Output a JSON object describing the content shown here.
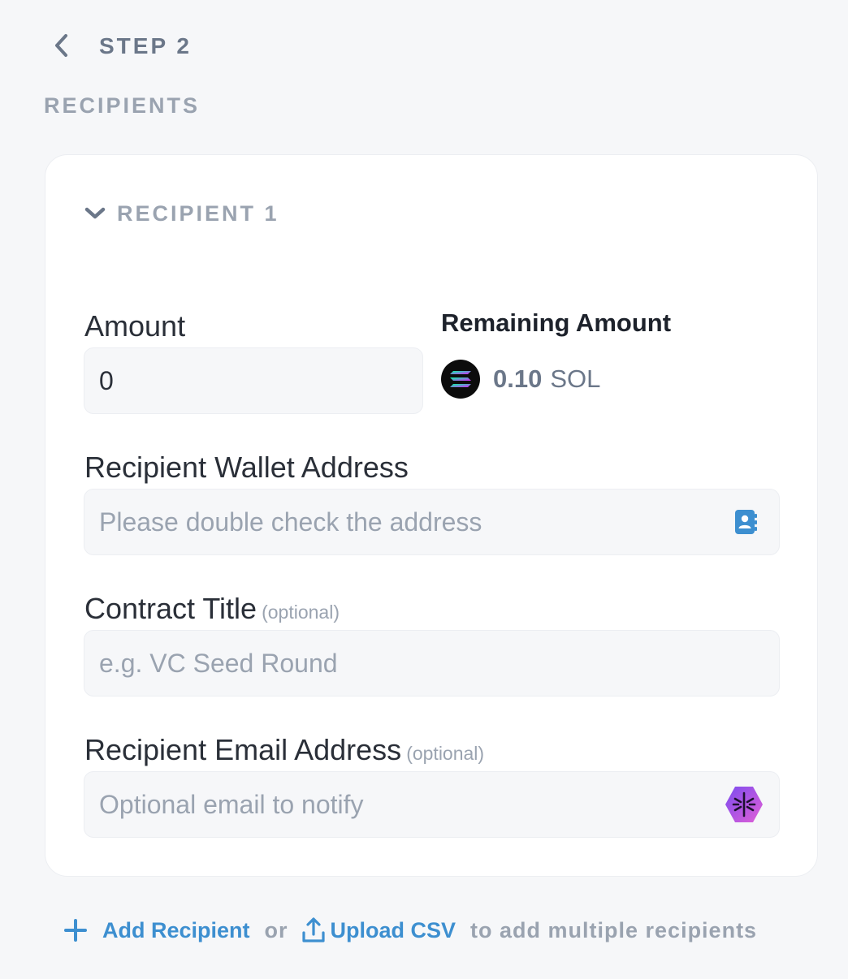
{
  "header": {
    "step_label": "STEP 2",
    "section_title": "RECIPIENTS"
  },
  "recipient": {
    "title": "RECIPIENT 1",
    "amount": {
      "label": "Amount",
      "value": "0"
    },
    "remaining": {
      "title": "Remaining Amount",
      "value": "0.10",
      "unit": "SOL",
      "token_icon": "solana-logo-icon"
    },
    "wallet": {
      "label": "Recipient Wallet Address",
      "placeholder": "Please double check the address",
      "icon": "address-book-icon"
    },
    "contract_title": {
      "label": "Contract Title",
      "optional": "(optional)",
      "placeholder": "e.g. VC Seed Round"
    },
    "email": {
      "label": "Recipient Email Address",
      "optional": "(optional)",
      "placeholder": "Optional email to notify",
      "icon": "notify-integration-icon"
    }
  },
  "footer": {
    "add_label": "Add Recipient",
    "or_text": "or",
    "upload_label": "Upload CSV",
    "suffix": "to add multiple recipients"
  },
  "colors": {
    "background": "#f6f7f9",
    "card": "#ffffff",
    "accent": "#3d8fd0",
    "muted": "#9aa3b0",
    "heading": "#6b7789",
    "text": "#2a2f38"
  }
}
